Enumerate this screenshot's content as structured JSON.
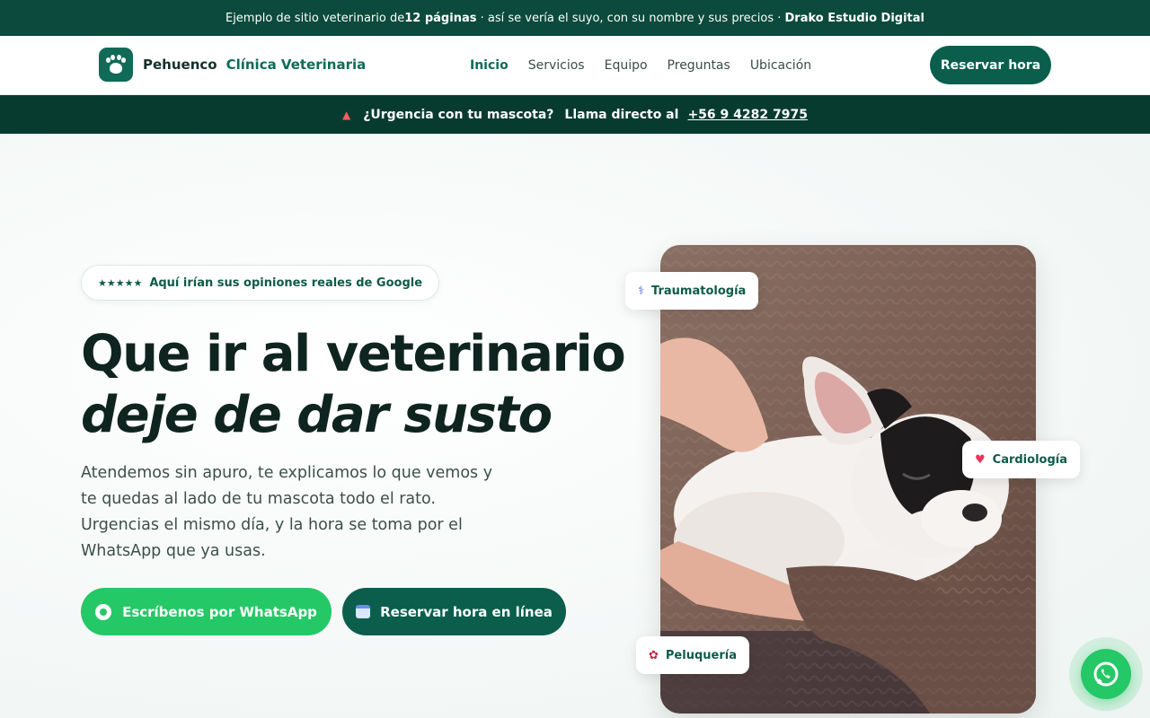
{
  "topbar": {
    "prefix": "Ejemplo de sitio veterinario de ",
    "pages": "12 páginas",
    "middle": " · así se vería el suyo, con su nombre y sus precios · ",
    "studio": "Drako Estudio Digital"
  },
  "header": {
    "brand_name": "Pehuenco",
    "brand_sub": "Clínica Veterinaria",
    "nav": [
      "Inicio",
      "Servicios",
      "Equipo",
      "Preguntas",
      "Ubicación"
    ],
    "cta": "Reservar hora"
  },
  "urgent": {
    "question": "¿Urgencia con tu mascota?",
    "call_label": "Llama directo al",
    "phone": "+56 9 4282 7975"
  },
  "hero": {
    "rating_stars": "★★★★★",
    "rating_text": "Aquí irían sus opiniones reales de Google",
    "title_line1": "Que ir al veterinario",
    "title_line2": "deje de dar susto",
    "lead": "Atendemos sin apuro, te explicamos lo que vemos y te quedas al lado de tu mascota todo el rato. Urgencias el mismo día, y la hora se toma por el WhatsApp que ya usas.",
    "btn_whatsapp": "Escríbenos por WhatsApp",
    "btn_online": "Reservar hora en línea"
  },
  "chips": {
    "trauma": "Traumatología",
    "cardio": "Cardiología",
    "grooming": "Peluquería"
  },
  "colors": {
    "brand": "#0b5e4c",
    "topbar": "#0b4a3c",
    "urgent_bar": "#073b30",
    "whatsapp": "#25c866"
  }
}
